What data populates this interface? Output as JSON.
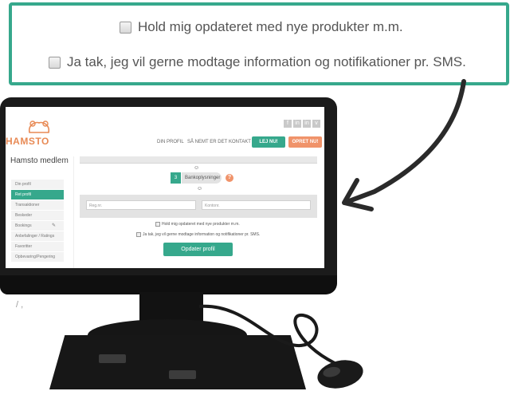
{
  "callout": {
    "checkbox_newsletter": "Hold mig opdateret med nye produkter m.m.",
    "checkbox_sms": "Ja tak, jeg vil gerne modtage information og notifikationer pr. SMS."
  },
  "site": {
    "logo_text": "HAMSTO",
    "social_icons": [
      "f",
      "in",
      "in",
      "v"
    ],
    "nav": {
      "profile": "DIN PROFIL",
      "how": "SÅ NEMT ER DET",
      "contact": "KONTAKT"
    },
    "rent_button": "LEJ NU!",
    "create_button": "OPRET NU!",
    "member_title": "Hamsto medlem",
    "sidebar": [
      {
        "label": "Din profil",
        "active": false
      },
      {
        "label": "Ret profil",
        "active": true
      },
      {
        "label": "Transaktioner",
        "active": false
      },
      {
        "label": "Beskeder",
        "active": false
      },
      {
        "label": "Bookings",
        "active": false
      },
      {
        "label": "Anbefalinger / Ratings",
        "active": false
      },
      {
        "label": "Favoritter",
        "active": false
      },
      {
        "label": "Opbevaring/Pengering",
        "active": false
      }
    ],
    "step": {
      "number": "3",
      "label": "Bankoplysninger"
    },
    "bank": {
      "reg_placeholder": "Reg.nr.",
      "account_placeholder": "Kontonr."
    },
    "check_newsletter": "Hold mig opdateret med nye produkter m.m.",
    "check_sms": "Ja tak, jeg vil gerne modtage information og notifikationer pr. SMS.",
    "update_button": "Opdater profil"
  },
  "colors": {
    "accent_green": "#36a88c",
    "accent_orange": "#f0936a"
  }
}
